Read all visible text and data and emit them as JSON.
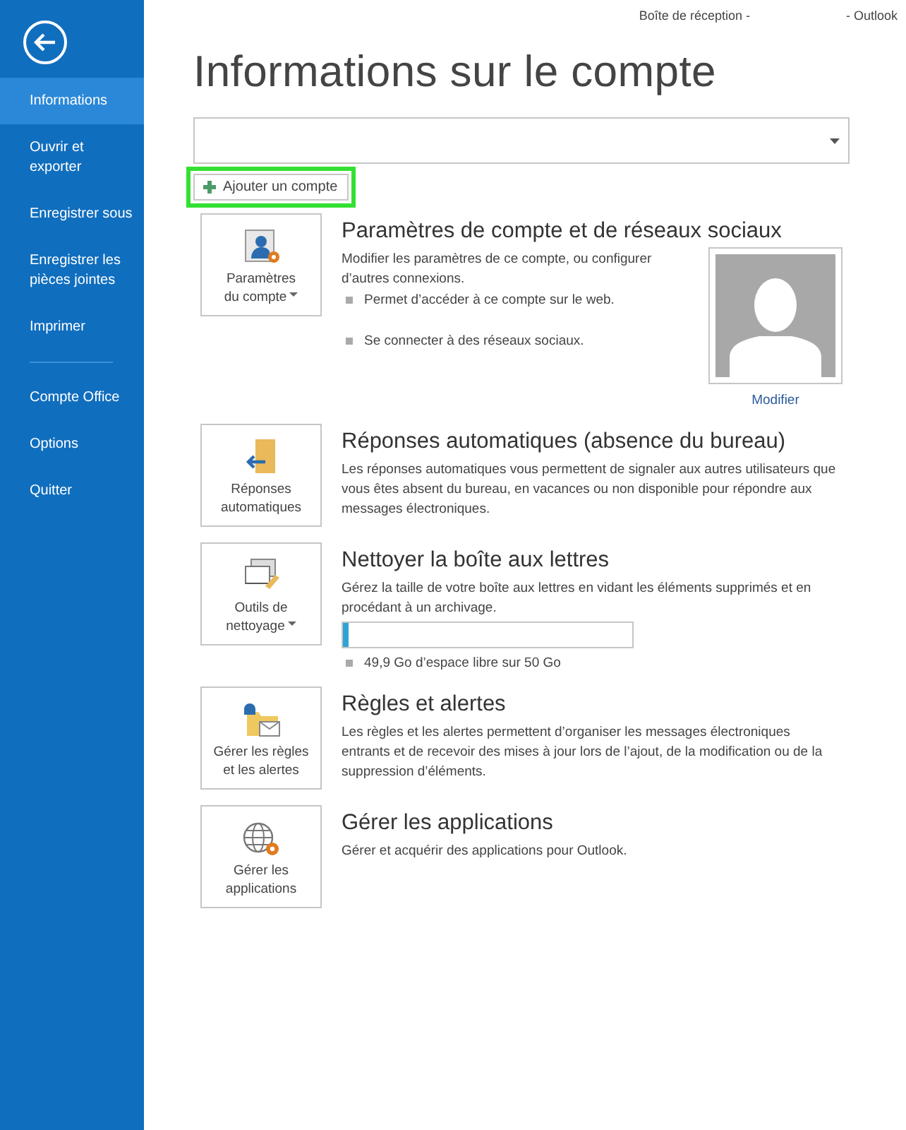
{
  "window": {
    "title_left": "Boîte de réception -",
    "title_right": "- Outlook"
  },
  "sidebar": {
    "groups": [
      {
        "items": [
          {
            "label": "Informations",
            "selected": true
          },
          {
            "label": "Ouvrir et\nexporter",
            "selected": false
          },
          {
            "label": "Enregistrer sous",
            "selected": false
          },
          {
            "label": "Enregistrer les\npièces jointes",
            "selected": false
          },
          {
            "label": "Imprimer",
            "selected": false
          }
        ]
      },
      {
        "items": [
          {
            "label": "Compte Office",
            "selected": false
          },
          {
            "label": "Options",
            "selected": false
          },
          {
            "label": "Quitter",
            "selected": false
          }
        ]
      }
    ]
  },
  "page_title": "Informations sur le compte",
  "add_account": {
    "label": "Ajouter un compte",
    "highlighted": true
  },
  "sections": [
    {
      "kind": "account",
      "tile": "Paramètres\ndu compte",
      "dropdown": true,
      "heading": "Paramètres de compte et de réseaux sociaux",
      "description": "Modifier les paramètres de ce compte, ou configurer d’autres connexions.",
      "bullets": [
        "Permet d’accéder à ce compte sur le web.",
        "Se connecter à des réseaux sociaux."
      ],
      "photo_link": "Modifier"
    },
    {
      "kind": "auto-reply",
      "tile": "Réponses\nautomatiques",
      "dropdown": false,
      "heading": "Réponses automatiques (absence du bureau)",
      "description": "Les réponses automatiques vous permettent de signaler aux autres utilisateurs que vous êtes absent du bureau, en vacances ou non disponible pour répondre aux messages électroniques."
    },
    {
      "kind": "cleanup",
      "tile": "Outils de\nnettoyage",
      "dropdown": true,
      "heading": "Nettoyer la boîte aux lettres",
      "description": "Gérez la taille de votre boîte aux lettres en vidant les éléments supprimés et en procédant à un archivage.",
      "storage": {
        "level": 0.02,
        "note": "49,9 Go d’espace libre sur 50 Go"
      }
    },
    {
      "kind": "rules",
      "tile": "Gérer les règles\net les alertes",
      "dropdown": false,
      "heading": "Règles et alertes",
      "description": "Les règles et les alertes permettent d’organiser les messages électroniques entrants et de recevoir des mises à jour lors de l’ajout, de la modification ou de la suppression d’éléments."
    },
    {
      "kind": "apps",
      "tile": "Gérer les\napplications",
      "dropdown": false,
      "heading": "Gérer les applications",
      "description": "Gérer et acquérir des applications pour Outlook."
    }
  ]
}
